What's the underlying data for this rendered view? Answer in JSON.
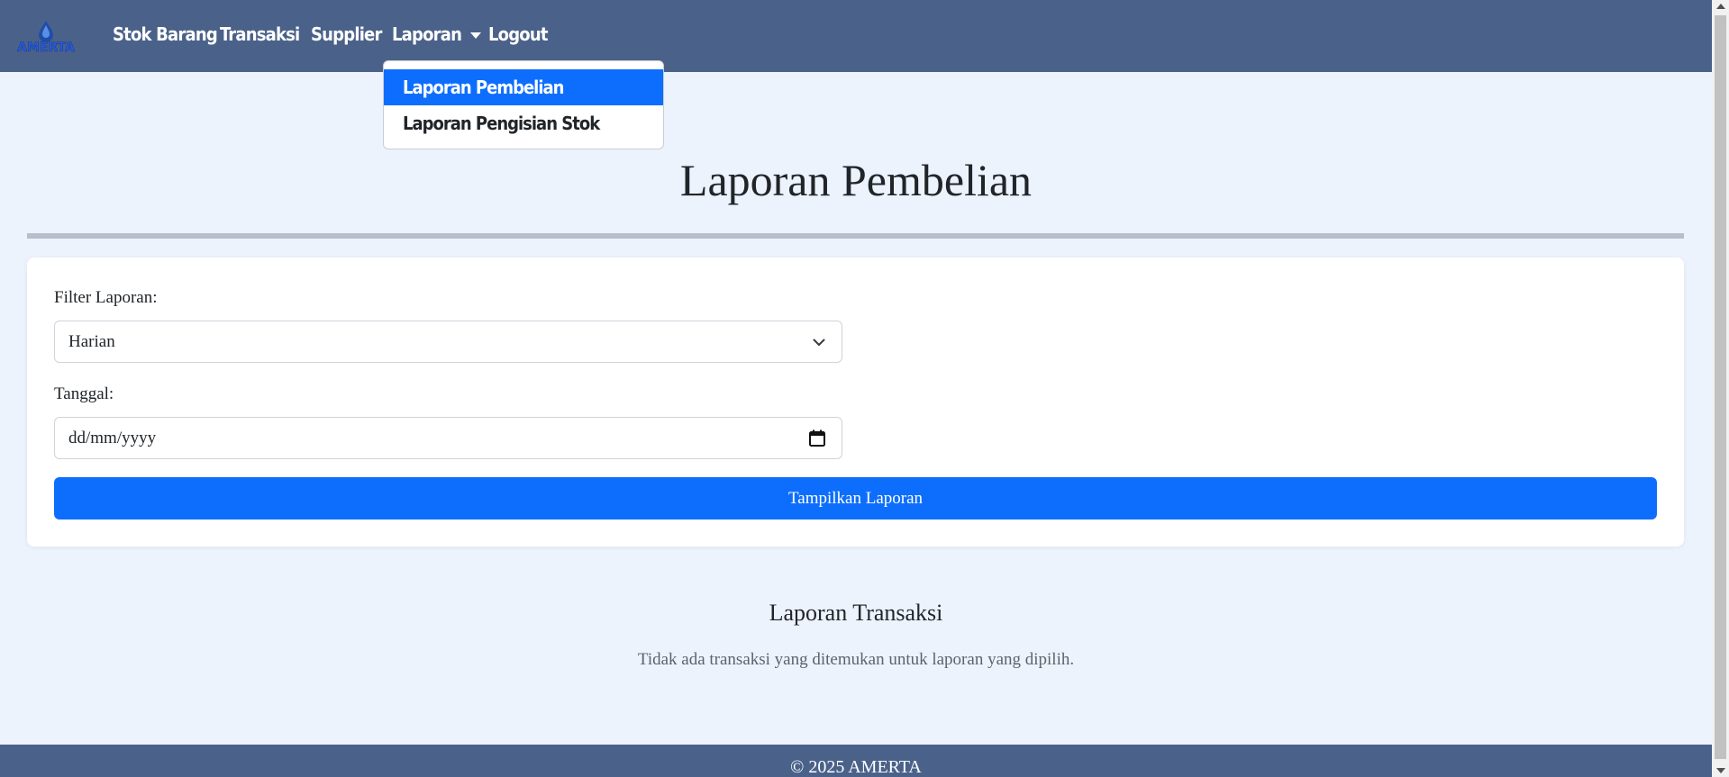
{
  "navbar": {
    "brand": "AMERTA",
    "links": [
      "Stok Barang",
      "Transaksi",
      "Supplier",
      "Laporan",
      "Logout"
    ]
  },
  "dropdown": {
    "items": [
      "Laporan Pembelian",
      "Laporan Pengisian Stok"
    ],
    "active_index": 0
  },
  "page": {
    "title": "Laporan Pembelian"
  },
  "filter": {
    "filter_label": "Filter Laporan:",
    "filter_value": "Harian",
    "date_label": "Tanggal:",
    "date_placeholder": "dd/mm/yyyy",
    "submit_label": "Tampilkan Laporan"
  },
  "report": {
    "title": "Laporan Transaksi",
    "empty_message": "Tidak ada transaksi yang ditemukan untuk laporan yang dipilih."
  },
  "footer": {
    "text": "© 2025 AMERTA"
  },
  "colors": {
    "navbar_bg": "#4a6289",
    "page_bg": "#edf3fd",
    "primary": "#0d6efd"
  },
  "icons": {
    "logo": "water-drop-logo",
    "dropdown_caret": "caret-down-icon",
    "select": "chevron-down-icon",
    "date": "calendar-icon"
  }
}
